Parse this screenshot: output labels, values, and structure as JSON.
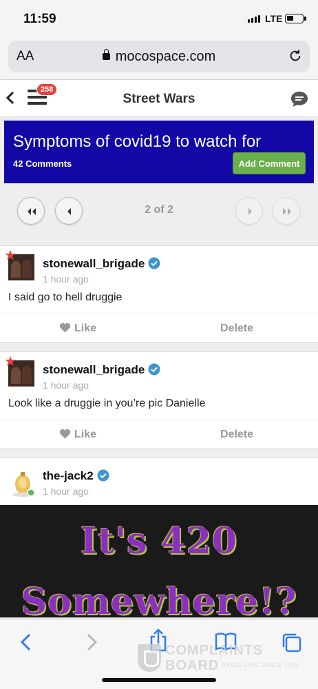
{
  "status_bar": {
    "time": "11:59",
    "network": "LTE"
  },
  "browser": {
    "text_size_label": "AA",
    "url": "mocospace.com"
  },
  "header": {
    "title": "Street Wars",
    "notification_count": "258"
  },
  "topic": {
    "title": "Symptoms of covid19 to watch for",
    "comment_count": "42 Comments",
    "add_comment_label": "Add Comment",
    "color": "#1308a6",
    "add_button_color": "#6ab04c"
  },
  "pager": {
    "page_info": "2 of 2"
  },
  "comments": [
    {
      "username": "stonewall_brigade",
      "time_ago": "1 hour ago",
      "message": "I said go to hell druggie",
      "like_label": "Like",
      "delete_label": "Delete"
    },
    {
      "username": "stonewall_brigade",
      "time_ago": "1 hour ago",
      "message": "Look like a druggie in you’re pic Danielle",
      "like_label": "Like",
      "delete_label": "Delete"
    },
    {
      "username": "the-jack2",
      "time_ago": "1 hour ago",
      "image_text_line1": "It's 420",
      "image_text_line2": "Somewhere!?"
    }
  ],
  "watermark": {
    "line1": "COMPLAINTS",
    "line2": "BOARD",
    "tagline": "RESOLVING SINCE 2004"
  },
  "icons": {
    "lock": "lock-icon",
    "reload": "reload-icon",
    "back": "chevron-left-icon",
    "menu": "hamburger-menu-icon",
    "chat": "chat-bubble-icon",
    "verified": "verified-check-icon",
    "like": "heart-icon",
    "share": "share-icon",
    "bookmarks": "book-icon",
    "tabs": "tabs-icon"
  }
}
